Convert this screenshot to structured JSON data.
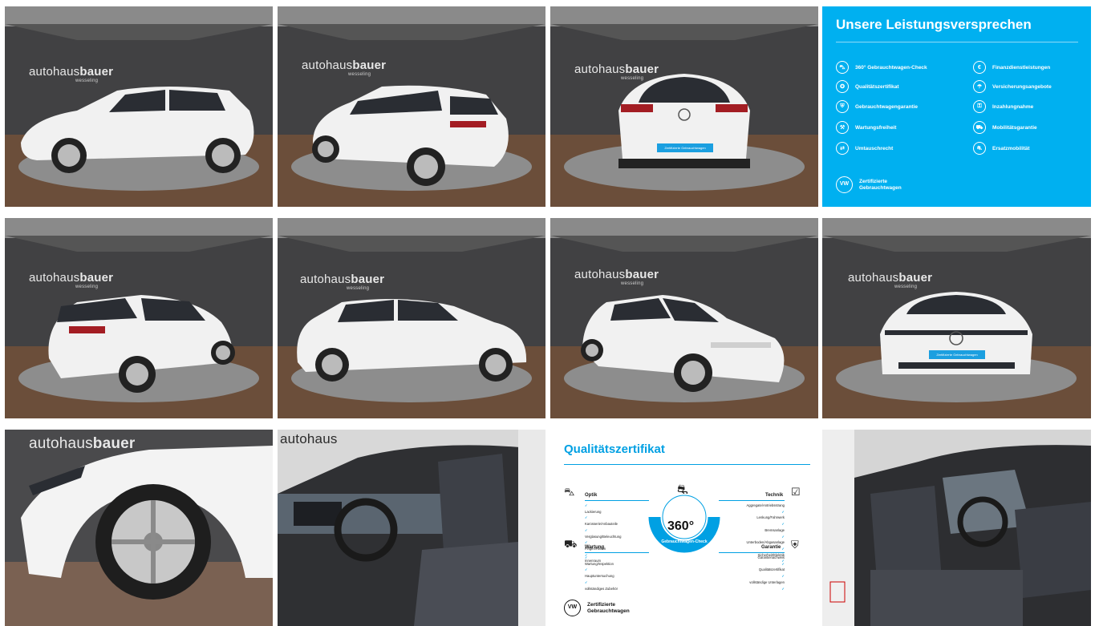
{
  "gallery": {
    "watermark": {
      "brand_light": "autohaus",
      "brand_bold": "bauer",
      "location": "wesseling"
    },
    "photos": [
      {
        "id": "side-left",
        "plate": ""
      },
      {
        "id": "rear-left",
        "plate": ""
      },
      {
        "id": "rear",
        "plate": "Zertifizierte Gebrauchtwagen"
      },
      {
        "id": "rear-left-2",
        "plate": ""
      },
      {
        "id": "side-right",
        "plate": ""
      },
      {
        "id": "front-right",
        "plate": ""
      },
      {
        "id": "front",
        "plate": "Zertifizierte Gebrauchtwagen"
      },
      {
        "id": "wheel-detail",
        "plate": ""
      },
      {
        "id": "interior-driver",
        "plate": ""
      },
      {
        "id": "interior-passenger",
        "plate": ""
      }
    ]
  },
  "promise": {
    "title": "Unsere Leistungsversprechen",
    "left": [
      "360° Gebrauchtwagen-Check",
      "Qualitätszertifikat",
      "Gebrauchtwagengarantie",
      "Wartungsfreiheit",
      "Umtauschrecht"
    ],
    "right": [
      "Finanzdienstleistungen",
      "Versicherungsangebote",
      "Inzahlungnahme",
      "Mobilitätsgarantie",
      "Ersatzmobilität"
    ],
    "footer_line1": "Zertifizierte",
    "footer_line2": "Gebrauchtwagen",
    "logo_text": "VW"
  },
  "certificate": {
    "title": "Qualitätszertifikat",
    "optik": {
      "title": "Optik",
      "items": [
        "Lackierung",
        "Karosserie/Anbauteile",
        "Verglasung/Beleuchtung",
        "Felgen/Reifen",
        "Innenraum"
      ]
    },
    "wartung": {
      "title": "Wartung",
      "items": [
        "Wartung/Inspektion",
        "Hauptuntersuchung",
        "vollständiges Zubehör"
      ]
    },
    "technik": {
      "title": "Technik",
      "items": [
        "Aggregate/Antriebsstrang",
        "Lenkung/Fahrwerk",
        "Bremsanlage",
        "Unterboden/Abgasanlage",
        "Sicherheit/Elektrik"
      ]
    },
    "garantie": {
      "title": "Garantie",
      "items": [
        "Garantienachweis",
        "Qualitätszertifikat",
        "vollständige Unterlagen"
      ]
    },
    "badge_number": "360°",
    "badge_ring": "Gebrauchtwagen-Check",
    "footer_line1": "Zertifizierte",
    "footer_line2": "Gebrauchtwagen",
    "logo_text": "VW"
  },
  "colors": {
    "vw_blue": "#00b0f0",
    "cert_blue": "#00a0e3"
  }
}
